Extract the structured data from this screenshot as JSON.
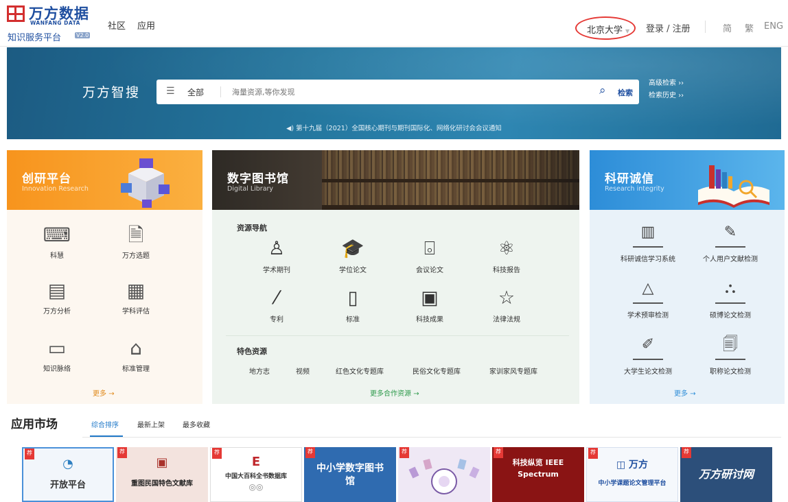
{
  "header": {
    "logo_cn": "万方数据",
    "logo_en": "WANFANG DATA",
    "logo_sub": "知识服务平台",
    "logo_ver": "V2.0",
    "nav": [
      "社区",
      "应用"
    ],
    "campus": "北京大学",
    "login": "登录 / 注册",
    "lang": [
      "简",
      "繁",
      "ENG"
    ]
  },
  "hero": {
    "title": "万方智搜",
    "scope": "全部",
    "placeholder": "海量资源,等你发现",
    "search_btn": "检索",
    "adv_search": "高级检索",
    "history": "检索历史",
    "notice": "第十九届（2021）全国核心期刊与期刊国际化、网络化研讨会会议通知"
  },
  "innovation": {
    "title": "创研平台",
    "subtitle": "Innovation Research",
    "items": [
      {
        "label": "科慧",
        "icon": "globe-keyboard-icon"
      },
      {
        "label": "万方选题",
        "icon": "document-pen-icon"
      },
      {
        "label": "万方分析",
        "icon": "chart-board-icon"
      },
      {
        "label": "学科评估",
        "icon": "calendar-check-icon"
      },
      {
        "label": "知识脉络",
        "icon": "card-link-icon"
      },
      {
        "label": "标准管理",
        "icon": "building-icon"
      }
    ],
    "more": "更多"
  },
  "library": {
    "title": "数字图书馆",
    "subtitle": "Digital Library",
    "nav_title": "资源导航",
    "items": [
      {
        "label": "学术期刊",
        "icon": "person-desk-icon"
      },
      {
        "label": "学位论文",
        "icon": "graduation-cap-icon"
      },
      {
        "label": "会议论文",
        "icon": "easel-icon"
      },
      {
        "label": "科技报告",
        "icon": "atom-icon"
      },
      {
        "label": "专利",
        "icon": "wand-icon"
      },
      {
        "label": "标准",
        "icon": "book-mark-icon"
      },
      {
        "label": "科技成果",
        "icon": "monitor-icon"
      },
      {
        "label": "法律法规",
        "icon": "star-frame-icon"
      }
    ],
    "special_title": "特色资源",
    "special": [
      "地方志",
      "视频",
      "红色文化专题库",
      "民俗文化专题库",
      "家训家风专题库"
    ],
    "more": "更多合作资源"
  },
  "integrity": {
    "title": "科研诚信",
    "subtitle": "Research integrity",
    "items": [
      {
        "label": "科研诚信学习系统",
        "icon": "study-book-icon"
      },
      {
        "label": "个人用户文献检测",
        "icon": "edit-doc-icon"
      },
      {
        "label": "学术预审检测",
        "icon": "warning-triangle-icon"
      },
      {
        "label": "硕博论文检测",
        "icon": "graduate-icon"
      },
      {
        "label": "大学生论文检测",
        "icon": "pencil-icon"
      },
      {
        "label": "职称论文检测",
        "icon": "doc-search-icon"
      }
    ],
    "more": "更多"
  },
  "market": {
    "title": "应用市场",
    "tabs": [
      "综合排序",
      "最新上架",
      "最多收藏"
    ],
    "rec": "荐",
    "apps": [
      {
        "name": "开放平台",
        "bg": "#f2f6fb"
      },
      {
        "name": "重图民国特色文献库",
        "bg": "#f3e3de"
      },
      {
        "name": "中国大百科全书数据库",
        "bg": "#ffffff"
      },
      {
        "name": "中小学数字图书馆",
        "bg": "#2f6bb0"
      },
      {
        "name": "",
        "bg": "#efe8f5"
      },
      {
        "name": "科技纵览 IEEE Spectrum",
        "bg": "#8a1414"
      },
      {
        "name": "中小学课题论文管理平台",
        "bg": "#f5f8fc"
      },
      {
        "name": "万方研讨网",
        "bg": "#2c4f7a"
      }
    ]
  }
}
